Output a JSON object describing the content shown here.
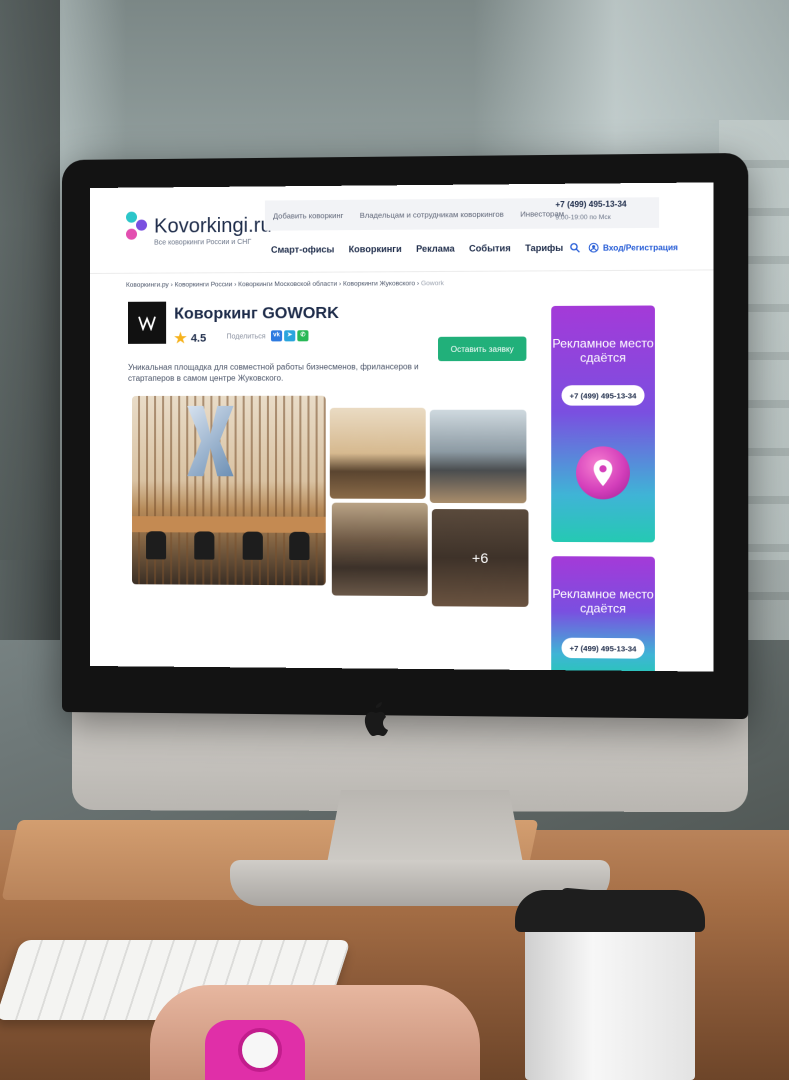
{
  "header": {
    "logo_title": "Kovorkingi.ru",
    "logo_subtitle": "Все коворкинги России и СНГ",
    "top_links": [
      "Добавить коворкинг",
      "Владельцам и сотрудникам коворкингов",
      "Инвесторам"
    ],
    "phone": "+7 (499) 495-13-34",
    "hours": "9:00-19:00 по Мск",
    "nav": [
      "Смарт-офисы",
      "Коворкинги",
      "Реклама",
      "События",
      "Тарифы"
    ],
    "login": "Вход/Регистрация"
  },
  "breadcrumb": {
    "path": "Коворкинги.ру › Коворкинги России › Коворкинги Московской области › Коворкинги Жуковского ›",
    "current": "Gowork"
  },
  "listing": {
    "title": "Коворкинг GOWORK",
    "rating": "4.5",
    "share_label": "Поделиться",
    "social": [
      "vk",
      "telegram",
      "whatsapp"
    ],
    "cta": "Оставить заявку",
    "description": "Уникальная площадка для совместной работы бизнесменов, фрилансеров и стартаперов в самом центре Жуковского.",
    "gallery_more": "+6"
  },
  "ads": [
    {
      "title": "Рекламное место сдаётся",
      "phone": "+7 (499) 495-13-34"
    },
    {
      "title": "Рекламное место сдаётся",
      "phone": "+7 (499) 495-13-34"
    }
  ],
  "colors": {
    "accent_green": "#21b07a",
    "link_blue": "#245bd6",
    "brand_dark": "#1e2c4a",
    "ad_purple": "#a43ad8",
    "ad_teal": "#25c9b3"
  }
}
